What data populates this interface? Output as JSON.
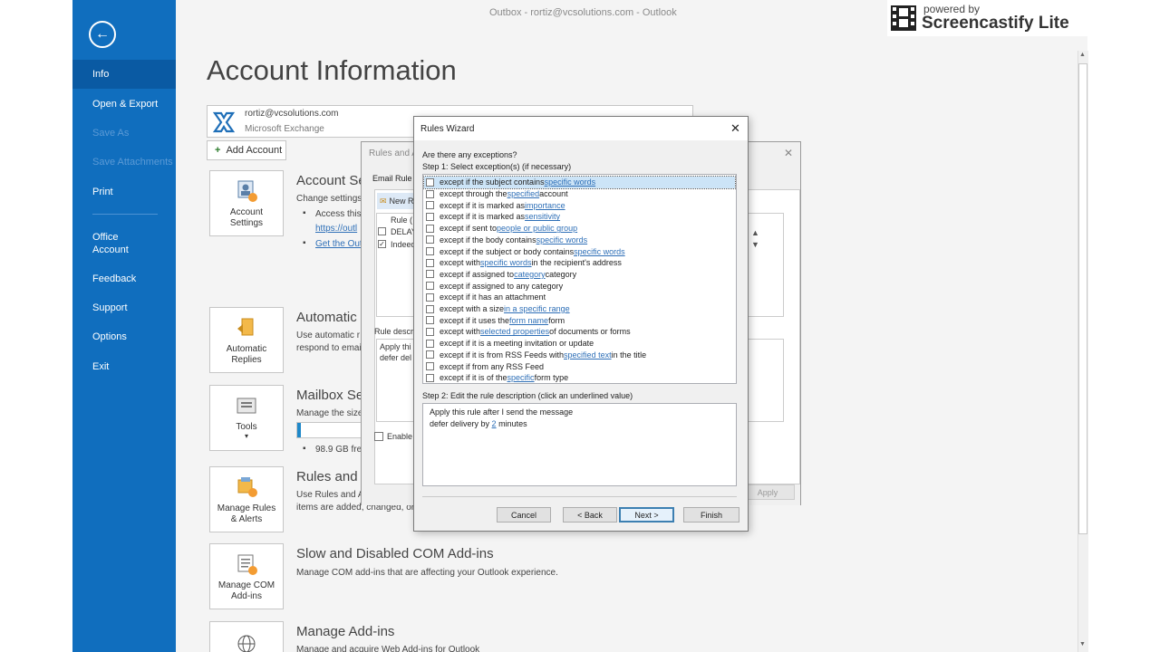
{
  "window": {
    "title": "Outbox - rortiz@vcsolutions.com  -  Outlook"
  },
  "sidebar": {
    "items": [
      {
        "label": "Info"
      },
      {
        "label": "Open & Export"
      },
      {
        "label": "Save As"
      },
      {
        "label": "Save Attachments"
      },
      {
        "label": "Print"
      },
      {
        "label": "Office\nAccount"
      },
      {
        "label": "Feedback"
      },
      {
        "label": "Support"
      },
      {
        "label": "Options"
      },
      {
        "label": "Exit"
      }
    ]
  },
  "main": {
    "page_title": "Account Information",
    "account": {
      "email": "rortiz@vcsolutions.com",
      "type": "Microsoft Exchange"
    },
    "add_account_label": "Add Account",
    "sections": {
      "account_settings": {
        "tile_label": "Account Settings",
        "title": "Account Se",
        "desc": "Change settings",
        "bullet1": "Access this",
        "link1": "https://outl",
        "link2": "Get the Out"
      },
      "automatic_replies": {
        "tile_label": "Automatic Replies",
        "title": "Automatic",
        "desc1": "Use automatic r",
        "desc2": "respond to emai"
      },
      "mailbox": {
        "tile_label": "Tools",
        "title": "Mailbox Se",
        "desc": "Manage the size",
        "storage": "98.9 GB free"
      },
      "rules": {
        "tile_label": "Manage Rules & Alerts",
        "title": "Rules and",
        "desc1": "Use Rules and A",
        "desc2": "items are added, changed, or"
      },
      "com_addins": {
        "tile_label": "Manage COM Add-ins",
        "title": "Slow and Disabled COM Add-ins",
        "desc": "Manage COM add-ins that are affecting your Outlook experience."
      },
      "addins": {
        "title": "Manage Add-ins",
        "desc": "Manage and acquire Web Add-ins for Outlook"
      }
    }
  },
  "rules_dialog": {
    "title": "Rules and A",
    "email_rules_tab": "Email Rule",
    "new_rule": "New R",
    "column_rule": "Rule (",
    "rows": [
      "DELAY",
      "Indeed"
    ],
    "rule_desc_label": "Rule descr",
    "rule_desc_text1": "Apply thi",
    "rule_desc_text2": "defer del",
    "enable_label": "Enable",
    "apply_label": "Apply"
  },
  "wizard": {
    "title": "Rules Wizard",
    "question": "Are there any exceptions?",
    "step1": "Step 1: Select exception(s) (if necessary)",
    "conditions": [
      {
        "pre": "except if the subject contains ",
        "link": "specific words",
        "post": ""
      },
      {
        "pre": "except through the ",
        "link": "specified",
        "post": " account"
      },
      {
        "pre": "except if it is marked as ",
        "link": "importance",
        "post": ""
      },
      {
        "pre": "except if it is marked as ",
        "link": "sensitivity",
        "post": ""
      },
      {
        "pre": "except if sent to ",
        "link": "people or public group",
        "post": ""
      },
      {
        "pre": "except if the body contains ",
        "link": "specific words",
        "post": ""
      },
      {
        "pre": "except if the subject or body contains ",
        "link": "specific words",
        "post": ""
      },
      {
        "pre": "except with ",
        "link": "specific words",
        "post": " in the recipient's address"
      },
      {
        "pre": "except if assigned to ",
        "link": "category",
        "post": " category"
      },
      {
        "pre": "except if assigned to any category",
        "link": "",
        "post": ""
      },
      {
        "pre": "except if it has an attachment",
        "link": "",
        "post": ""
      },
      {
        "pre": "except with a size ",
        "link": "in a specific range",
        "post": ""
      },
      {
        "pre": "except if it uses the ",
        "link": "form name",
        "post": " form"
      },
      {
        "pre": "except with ",
        "link": "selected properties",
        "post": " of documents or forms"
      },
      {
        "pre": "except if it is a meeting invitation or update",
        "link": "",
        "post": ""
      },
      {
        "pre": "except if it is from RSS Feeds with ",
        "link": "specified text",
        "post": " in the title"
      },
      {
        "pre": "except if from any RSS Feed",
        "link": "",
        "post": ""
      },
      {
        "pre": "except if it is of the ",
        "link": "specific",
        "post": " form type"
      }
    ],
    "step2": "Step 2: Edit the rule description (click an underlined value)",
    "desc_line1": "Apply this rule after I send the message",
    "desc_line2_pre": "defer delivery by ",
    "desc_line2_link": "2",
    "desc_line2_post": " minutes",
    "buttons": {
      "cancel": "Cancel",
      "back": "< Back",
      "next": "Next >",
      "finish": "Finish"
    }
  },
  "watermark": {
    "powered": "powered by",
    "name": "Screencastify Lite"
  },
  "colors": {
    "sidebar": "#106ebe",
    "link": "#2e6fb7",
    "selection": "#cce4f7"
  }
}
